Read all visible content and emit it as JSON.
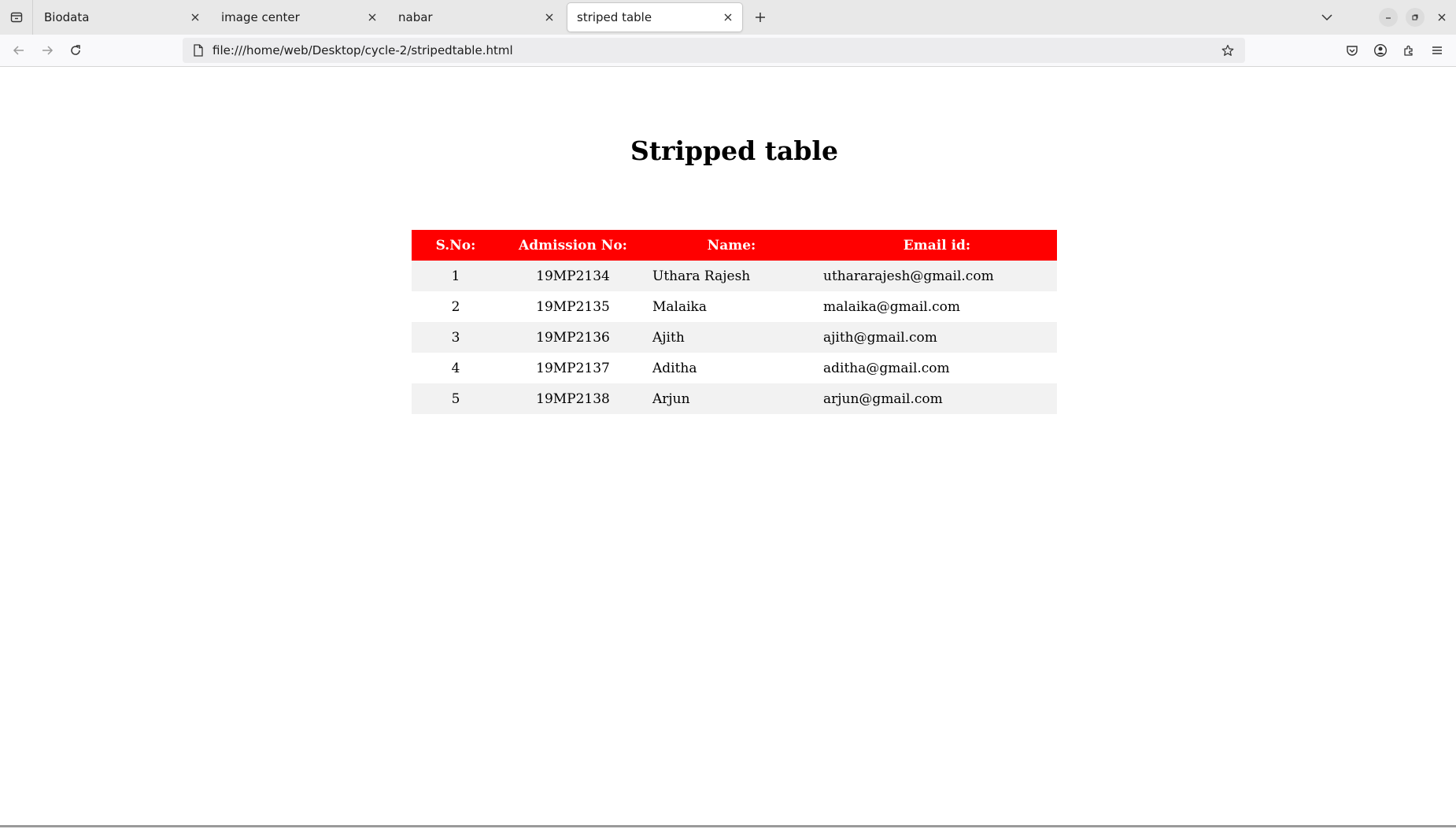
{
  "browser": {
    "tabs": [
      {
        "label": "Biodata",
        "active": false
      },
      {
        "label": "image center",
        "active": false
      },
      {
        "label": "nabar",
        "active": false
      },
      {
        "label": "striped table",
        "active": true
      }
    ],
    "url": "file:///home/web/Desktop/cycle-2/stripedtable.html"
  },
  "page": {
    "title": "Stripped table",
    "table": {
      "headers": [
        "S.No:",
        "Admission No:",
        "Name:",
        "Email id:"
      ],
      "rows": [
        {
          "sno": "1",
          "admission": "19MP2134",
          "name": "Uthara Rajesh",
          "email": "uthararajesh@gmail.com"
        },
        {
          "sno": "2",
          "admission": "19MP2135",
          "name": "Malaika",
          "email": "malaika@gmail.com"
        },
        {
          "sno": "3",
          "admission": "19MP2136",
          "name": "Ajith",
          "email": "ajith@gmail.com"
        },
        {
          "sno": "4",
          "admission": "19MP2137",
          "name": "Aditha",
          "email": "aditha@gmail.com"
        },
        {
          "sno": "5",
          "admission": "19MP2138",
          "name": "Arjun",
          "email": "arjun@gmail.com"
        }
      ],
      "header_color": "#ff0000",
      "stripe_color": "#f2f2f2"
    }
  }
}
